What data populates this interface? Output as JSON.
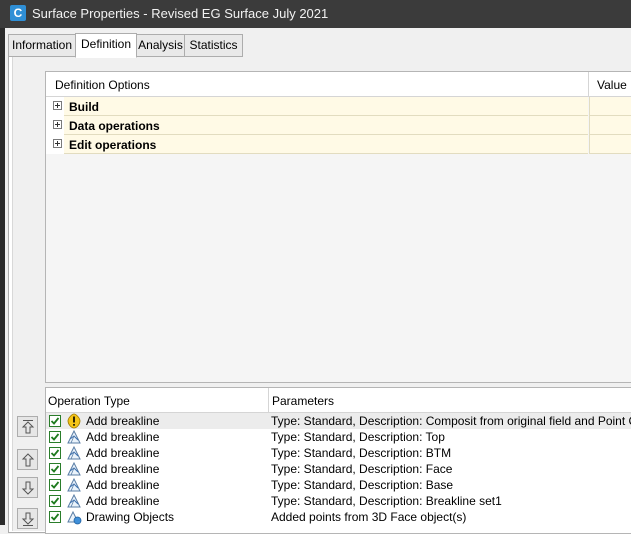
{
  "window": {
    "title": "Surface Properties - Revised EG Surface July 2021",
    "app_icon_letter": "C"
  },
  "tabs": [
    {
      "label": "Information"
    },
    {
      "label": "Definition"
    },
    {
      "label": "Analysis"
    },
    {
      "label": "Statistics"
    }
  ],
  "active_tab": "Definition",
  "definition_options": {
    "headers": {
      "option": "Definition Options",
      "value": "Value"
    },
    "rows": [
      {
        "label": "Build"
      },
      {
        "label": "Data operations"
      },
      {
        "label": "Edit operations"
      }
    ]
  },
  "operations": {
    "headers": {
      "type": "Operation Type",
      "params": "Parameters"
    },
    "rows": [
      {
        "type": "Add breakline",
        "params": "Type: Standard,  Description: Composit from original field and Point Cloud",
        "icon": "warning-icon",
        "checked": true,
        "selected": true
      },
      {
        "type": "Add breakline",
        "params": "Type: Standard,  Description: Top",
        "icon": "breakline-icon",
        "checked": true
      },
      {
        "type": "Add breakline",
        "params": "Type: Standard,  Description: BTM",
        "icon": "breakline-icon",
        "checked": true
      },
      {
        "type": "Add breakline",
        "params": "Type: Standard,  Description: Face",
        "icon": "breakline-icon",
        "checked": true
      },
      {
        "type": "Add breakline",
        "params": "Type: Standard,  Description: Base",
        "icon": "breakline-icon",
        "checked": true
      },
      {
        "type": "Add breakline",
        "params": "Type: Standard,  Description: Breakline set1",
        "icon": "breakline-icon",
        "checked": true
      },
      {
        "type": "Drawing Objects",
        "params": "Added points from 3D Face object(s)",
        "icon": "drawing-objects-icon",
        "checked": true
      }
    ]
  },
  "side_buttons": [
    {
      "icon": "move-top-icon"
    },
    {
      "icon": "move-up-icon"
    },
    {
      "icon": "move-down-icon"
    },
    {
      "icon": "move-bottom-icon"
    }
  ],
  "colors": {
    "titlebar": "#3b3b3b",
    "option_row_bg": "#fffae6",
    "warning": "#f5c518",
    "check": "#2a7d2a"
  }
}
